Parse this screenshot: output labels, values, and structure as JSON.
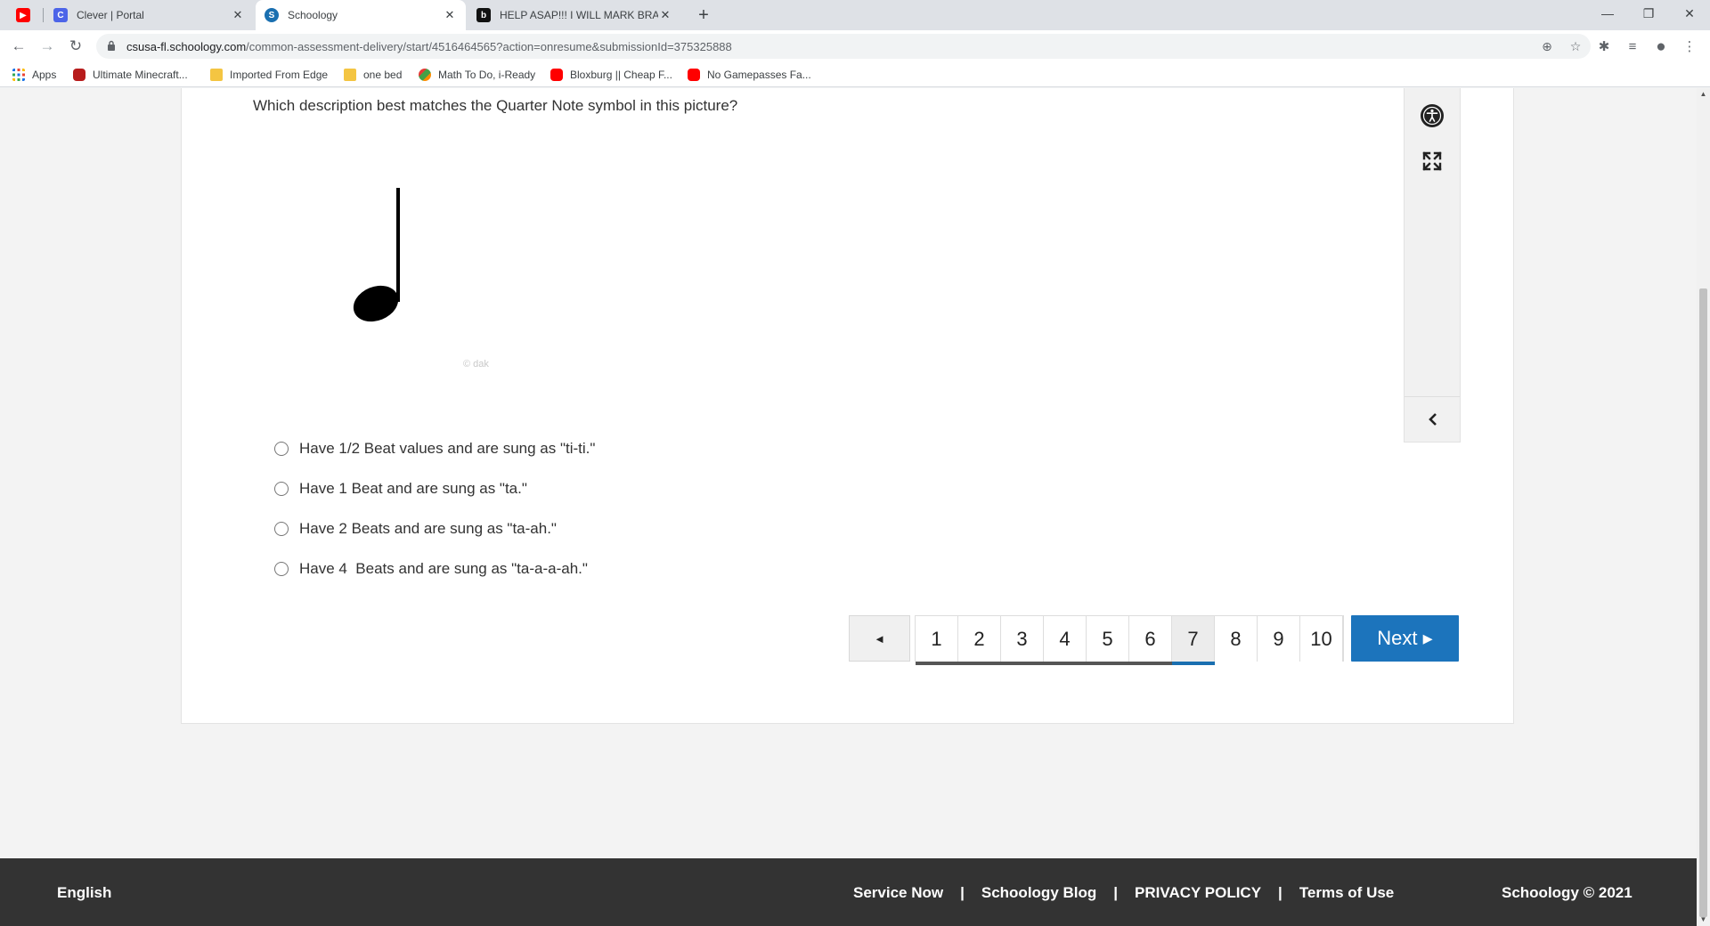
{
  "browser": {
    "tabs": [
      {
        "title": "",
        "favicon": "youtube-icon"
      },
      {
        "title": "Clever | Portal",
        "favicon": "clever-icon"
      },
      {
        "title": "Schoology",
        "favicon": "schoology-icon",
        "active": true
      },
      {
        "title": "HELP ASAP!!! I WILL MARK BRAI",
        "favicon": "brainly-icon"
      }
    ],
    "new_tab": "+",
    "url_host": "csusa-fl.schoology.com",
    "url_path": "/common-assessment-delivery/start/4516464565?action=onresume&submissionId=375325888",
    "bookmarks": [
      {
        "label": "Apps",
        "icon": "apps-grid-icon"
      },
      {
        "label": "Ultimate Minecraft...",
        "icon": "minecraft-icon"
      },
      {
        "label": "Imported From Edge",
        "icon": "folder-icon"
      },
      {
        "label": "one bed",
        "icon": "folder-icon"
      },
      {
        "label": "Math To Do, i-Ready",
        "icon": "iready-icon"
      },
      {
        "label": "Bloxburg || Cheap F...",
        "icon": "youtube-icon"
      },
      {
        "label": "No Gamepasses Fa...",
        "icon": "youtube-icon"
      }
    ]
  },
  "assessment": {
    "question": "Which description best matches the Quarter Note symbol in this picture?",
    "image_watermark": "© dak",
    "choices": [
      "Have 1/2 Beat values and are sung as \"ti-ti.\"",
      "Have 1 Beat and are sung as \"ta.\"",
      "Have 2 Beats and are sung as \"ta-ah.\"",
      "Have 4  Beats and are sung as \"ta-a-a-ah.\""
    ],
    "prev_label": "◄",
    "pages": [
      "1",
      "2",
      "3",
      "4",
      "5",
      "6",
      "7",
      "8",
      "9",
      "10"
    ],
    "current_page": "7",
    "next_label": "Next ▸"
  },
  "footer": {
    "language": "English",
    "links": [
      "Service Now",
      "Schoology Blog",
      "PRIVACY POLICY",
      "Terms of Use"
    ],
    "separator": "|",
    "copyright": "Schoology © 2021"
  },
  "colors": {
    "primary_button": "#1c74bc",
    "footer_bg": "#333333",
    "current_page_bg": "#ececec"
  }
}
